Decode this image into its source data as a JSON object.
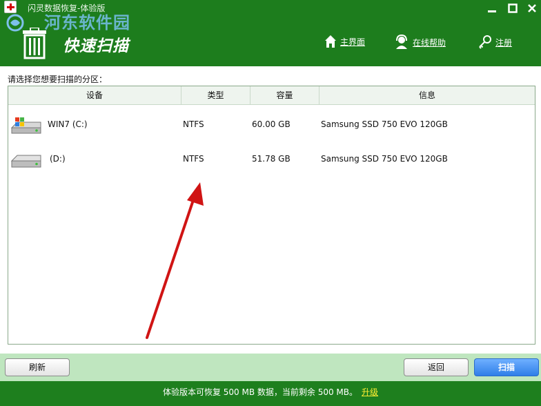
{
  "window": {
    "title": "闪灵数据恢复-体验版",
    "watermark": "河东软件园",
    "banner": "快速扫描",
    "controls": {
      "minimize": "—",
      "maximize": "□",
      "close": "✕"
    }
  },
  "nav": {
    "home": "主界面",
    "help": "在线帮助",
    "register": "注册"
  },
  "main": {
    "prompt": "请选择您想要扫描的分区：",
    "columns": [
      "设备",
      "类型",
      "容量",
      "信息"
    ],
    "rows": [
      {
        "name": "WIN7 (C:)",
        "type": "NTFS",
        "capacity": "60.00 GB",
        "info": "Samsung SSD 750 EVO 120GB",
        "icon": "windows-drive-icon"
      },
      {
        "name": "(D:)",
        "type": "NTFS",
        "capacity": "51.78 GB",
        "info": "Samsung SSD 750 EVO 120GB",
        "icon": "drive-icon"
      }
    ]
  },
  "buttons": {
    "refresh": "刷新",
    "back": "返回",
    "scan": "扫描"
  },
  "status": {
    "text": "体验版本可恢复 500 MB 数据，当前剩余 500 MB。",
    "upgrade": "升级"
  },
  "colors": {
    "header_green": "#1d7d1d",
    "button_bar": "#bfe6bf",
    "scan_button": "#2f7ee8",
    "arrow": "#d01414"
  }
}
